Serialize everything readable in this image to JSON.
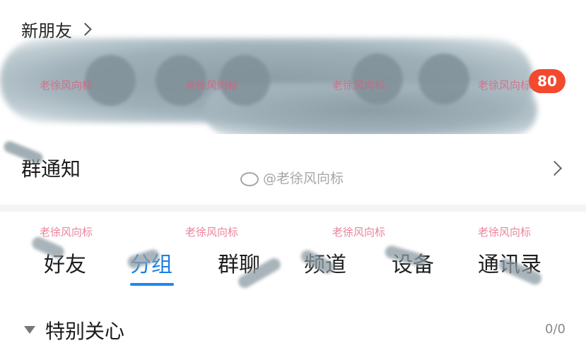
{
  "new_friends": {
    "title": "新朋友",
    "unread_badge": "80"
  },
  "group_notice": {
    "title": "群通知"
  },
  "contacts": {
    "tabs": [
      {
        "label": "好友",
        "active": false
      },
      {
        "label": "分组",
        "active": true
      },
      {
        "label": "群聊",
        "active": false
      },
      {
        "label": "频道",
        "active": false
      },
      {
        "label": "设备",
        "active": false
      },
      {
        "label": "通讯录",
        "active": false
      }
    ],
    "special_care": {
      "title": "特别关心",
      "count": "0/0"
    }
  },
  "watermarks": {
    "text": "老徐风向标",
    "weibo_handle": "@老徐风向标"
  },
  "colors": {
    "accent_blue": "#1d7fe0",
    "badge_red": "#f2492f",
    "watermark_pink": "#e05a78"
  }
}
